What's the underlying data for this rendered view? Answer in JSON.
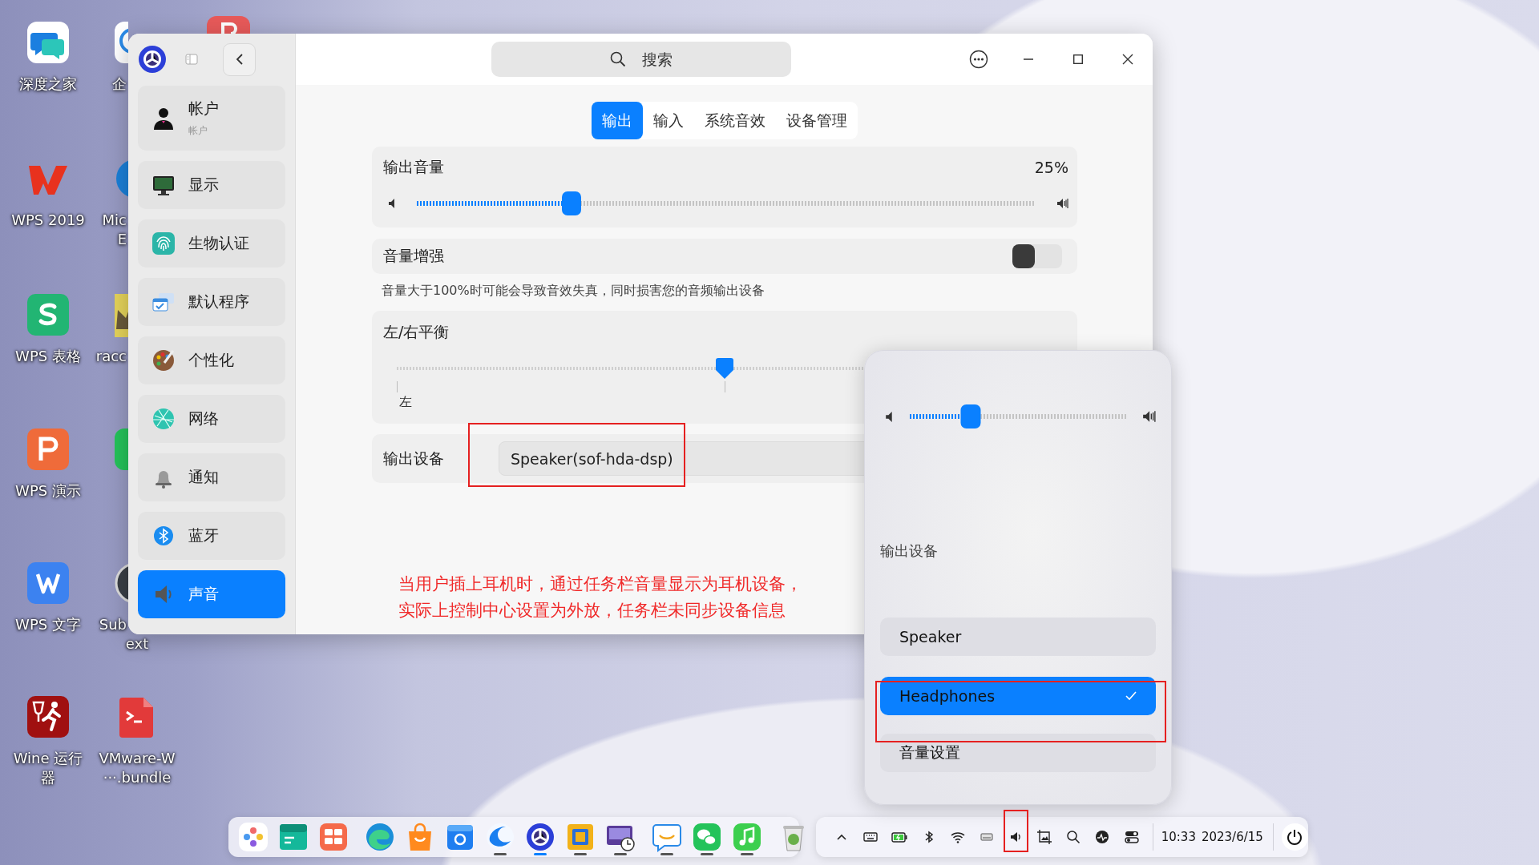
{
  "desktop": {
    "icons": [
      {
        "lines": [
          "深度之家"
        ]
      },
      {
        "lines": [
          "WPS 2019"
        ]
      },
      {
        "lines": [
          "WPS 表格"
        ]
      },
      {
        "lines": [
          "WPS 演示"
        ]
      },
      {
        "lines": [
          "WPS 文字"
        ]
      },
      {
        "lines": [
          "Wine 运行",
          "器"
        ]
      },
      {
        "lines": [
          "企"
        ]
      },
      {
        "lines": [
          "Mic",
          "E"
        ]
      },
      {
        "lines": [
          "racc"
        ]
      },
      {
        "lines": [
          "Sub",
          "ext"
        ]
      },
      {
        "lines": [
          "VMware-W",
          "···.bundle"
        ]
      }
    ]
  },
  "window": {
    "search": {
      "placeholder": "搜索"
    },
    "sidebar": {
      "items": [
        {
          "label": "帐户",
          "sublabel": "帐户",
          "selected": false
        },
        {
          "label": "显示",
          "selected": false
        },
        {
          "label": "生物认证",
          "selected": false
        },
        {
          "label": "默认程序",
          "selected": false
        },
        {
          "label": "个性化",
          "selected": false
        },
        {
          "label": "网络",
          "selected": false
        },
        {
          "label": "通知",
          "selected": false
        },
        {
          "label": "蓝牙",
          "selected": false
        },
        {
          "label": "声音",
          "selected": true
        }
      ]
    },
    "tabs": [
      {
        "label": "输出",
        "selected": true
      },
      {
        "label": "输入",
        "selected": false
      },
      {
        "label": "系统音效",
        "selected": false
      },
      {
        "label": "设备管理",
        "selected": false
      }
    ],
    "output_volume": {
      "label": "输出音量",
      "reading": "25%",
      "level": 0.25
    },
    "volume_boost": {
      "label": "音量增强",
      "on": false,
      "note": "音量大于100%时可能会导致音效失真，同时损害您的音频输出设备"
    },
    "balance": {
      "label": "左/右平衡",
      "level": 0.5,
      "left_label": "左"
    },
    "output_device": {
      "label": "输出设备",
      "value": "Speaker(sof-hda-dsp)"
    },
    "annotation": {
      "lines": [
        "当用户插上耳机时，通过任务栏音量显示为耳机设备，",
        "实际上控制中心设置为外放，任务栏未同步设备信息"
      ]
    }
  },
  "sound_popup": {
    "level": 0.28,
    "heading": "输出设备",
    "devices": [
      {
        "label": "Speaker",
        "selected": false
      },
      {
        "label": "Headphones",
        "selected": true
      }
    ],
    "settings_button": "音量设置"
  },
  "dock": {
    "groups": [
      [
        {
          "running": false,
          "active": false
        },
        {
          "running": false,
          "active": false
        },
        {
          "running": false,
          "active": false
        }
      ],
      [
        {
          "running": false,
          "active": false
        },
        {
          "running": false,
          "active": false
        },
        {
          "running": false,
          "active": false
        },
        {
          "running": true,
          "active": false
        },
        {
          "running": true,
          "active": true
        },
        {
          "running": true,
          "active": false
        },
        {
          "running": true,
          "active": false
        }
      ],
      [
        {
          "running": true,
          "active": false
        },
        {
          "running": true,
          "active": false
        },
        {
          "running": true,
          "active": false
        }
      ],
      [
        {
          "running": false,
          "active": false
        }
      ]
    ]
  },
  "tray": {
    "time": "10:33",
    "date": "2023/6/15"
  }
}
